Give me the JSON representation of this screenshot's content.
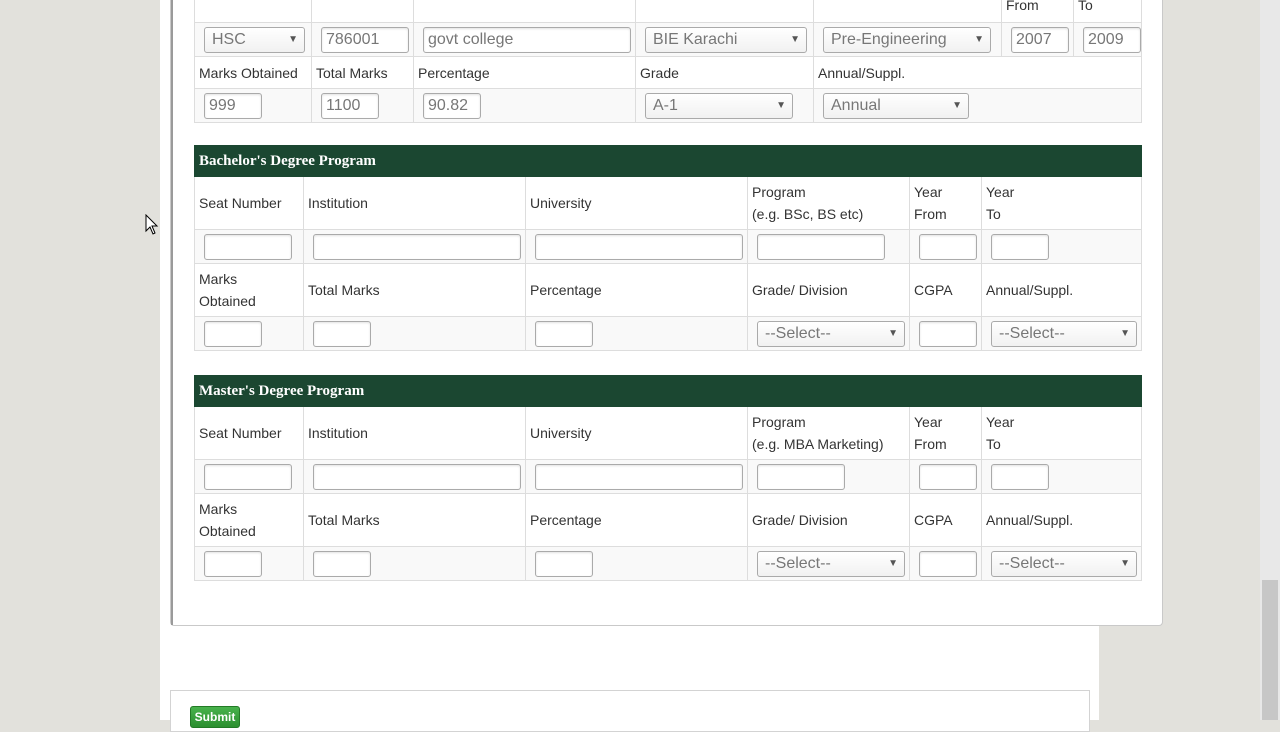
{
  "hsc": {
    "header_labels": {
      "year_from": "From",
      "year_to": "To"
    },
    "row1": {
      "exam": "HSC",
      "seat_number": "786001",
      "institution": "govt college",
      "board": "BIE Karachi",
      "group": "Pre-Engineering",
      "year_from": "2007",
      "year_to": "2009"
    },
    "labels": {
      "marks_obtained": "Marks Obtained",
      "total_marks": "Total Marks",
      "percentage": "Percentage",
      "grade": "Grade",
      "annual_suppl": "Annual/Suppl."
    },
    "row2": {
      "marks_obtained": "999",
      "total_marks": "1100",
      "percentage": "90.82",
      "grade": "A-1",
      "annual_suppl": "Annual"
    }
  },
  "bachelor": {
    "title": "Bachelor's Degree Program",
    "labels": {
      "seat_number": "Seat Number",
      "institution": "Institution",
      "university": "University",
      "program": "Program",
      "program_hint": "(e.g. BSc, BS etc)",
      "year_from_1": "Year",
      "year_from_2": "From",
      "year_to_1": "Year",
      "year_to_2": "To",
      "marks_1": "Marks",
      "marks_2": "Obtained",
      "total_marks": "Total Marks",
      "percentage": "Percentage",
      "grade_division": "Grade/ Division",
      "cgpa": "CGPA",
      "annual_suppl": "Annual/Suppl."
    },
    "grade_select": "--Select--",
    "annual_select": "--Select--"
  },
  "master": {
    "title": "Master's Degree Program",
    "labels": {
      "seat_number": "Seat Number",
      "institution": "Institution",
      "university": "University",
      "program": "Program",
      "program_hint": "(e.g. MBA Marketing)",
      "year_from_1": "Year",
      "year_from_2": "From",
      "year_to_1": "Year",
      "year_to_2": "To",
      "marks_1": "Marks",
      "marks_2": "Obtained",
      "total_marks": "Total Marks",
      "percentage": "Percentage",
      "grade_division": "Grade/ Division",
      "cgpa": "CGPA",
      "annual_suppl": "Annual/Suppl."
    },
    "grade_select": "--Select--",
    "annual_select": "--Select--"
  },
  "actions": {
    "submit_label": "Submit"
  },
  "colors": {
    "section_header": "#1b4731",
    "submit": "#2c8f30",
    "background": "#e2e1dc"
  }
}
